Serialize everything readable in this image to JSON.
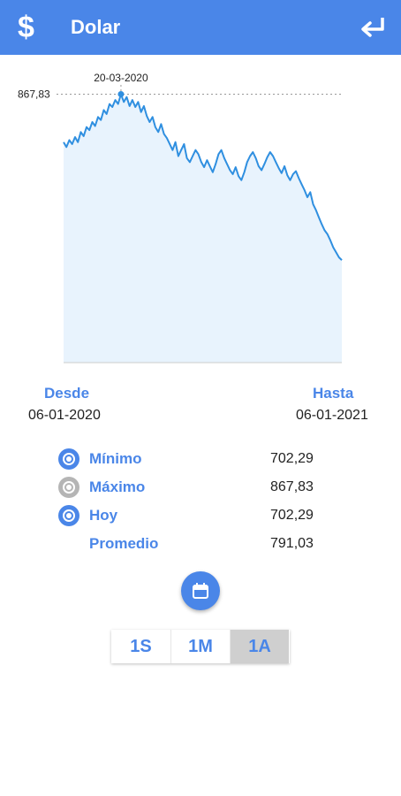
{
  "header": {
    "icon": "dollar-sign-icon",
    "title": "Dolar",
    "back_icon": "return-arrow-icon"
  },
  "chart_data": {
    "type": "area",
    "x_range": [
      "06-01-2020",
      "06-01-2021"
    ],
    "highlight": {
      "label": "20-03-2020",
      "value": "867,83"
    },
    "ylim": [
      600,
      900
    ],
    "series": [
      {
        "values": [
          820,
          815,
          822,
          818,
          825,
          820,
          830,
          826,
          835,
          832,
          840,
          836,
          845,
          842,
          852,
          848,
          858,
          855,
          862,
          858,
          867.83,
          860,
          865,
          856,
          862,
          855,
          860,
          850,
          856,
          846,
          840,
          845,
          835,
          830,
          838,
          828,
          824,
          818,
          812,
          820,
          806,
          812,
          818,
          804,
          800,
          806,
          812,
          808,
          800,
          795,
          802,
          796,
          790,
          798,
          808,
          812,
          804,
          798,
          792,
          788,
          795,
          786,
          782,
          790,
          800,
          806,
          810,
          804,
          796,
          792,
          798,
          805,
          810,
          806,
          800,
          794,
          789,
          796,
          787,
          782,
          788,
          791,
          784,
          778,
          772,
          765,
          770,
          758,
          752,
          745,
          738,
          732,
          728,
          722,
          715,
          710,
          705,
          702.29
        ]
      }
    ],
    "colors": {
      "line": "#2f8fe0",
      "fill": "#e8f3fd",
      "axis": "#cccccc"
    }
  },
  "range": {
    "from_label": "Desde",
    "from_date": "06-01-2020",
    "to_label": "Hasta",
    "to_date": "06-01-2021"
  },
  "stats": [
    {
      "label": "Mínimo",
      "value": "702,29",
      "icon": "target-icon",
      "icon_color": "#4a86e8"
    },
    {
      "label": "Máximo",
      "value": "867,83",
      "icon": "target-icon",
      "icon_color": "#b5b5b5"
    },
    {
      "label": "Hoy",
      "value": "702,29",
      "icon": "target-icon",
      "icon_color": "#4a86e8"
    },
    {
      "label": "Promedio",
      "value": "791,03"
    }
  ],
  "fab": {
    "icon": "calendar-icon"
  },
  "periods": [
    {
      "label": "1S",
      "active": false
    },
    {
      "label": "1M",
      "active": false
    },
    {
      "label": "1A",
      "active": true
    }
  ],
  "colors": {
    "accent": "#4a86e8",
    "active_period": "#cfcfcf"
  }
}
